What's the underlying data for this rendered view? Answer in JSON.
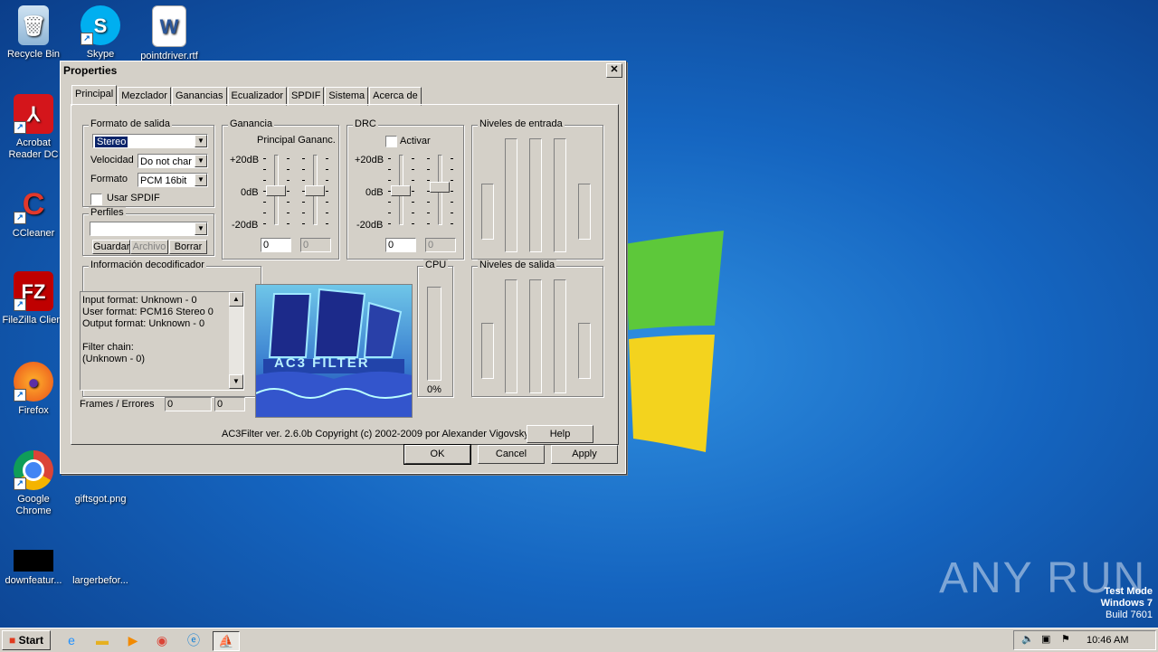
{
  "desktop": {
    "icons": [
      {
        "label": "Recycle Bin",
        "icon": "recycle-bin-icon"
      },
      {
        "label": "Skype",
        "icon": "skype-icon"
      },
      {
        "label": "pointdriver.rtf",
        "icon": "word-document-icon"
      },
      {
        "label": "Acrobat Reader DC",
        "icon": "acrobat-icon"
      },
      {
        "label": "CCleaner",
        "icon": "ccleaner-icon"
      },
      {
        "label": "FileZilla Client",
        "icon": "filezilla-icon"
      },
      {
        "label": "Firefox",
        "icon": "firefox-icon"
      },
      {
        "label": "Google Chrome",
        "icon": "chrome-icon"
      },
      {
        "label": "giftsgot.png",
        "icon": "image-file-icon"
      },
      {
        "label": "downfeatur...",
        "icon": "black-image-icon"
      },
      {
        "label": "largerbefor...",
        "icon": "image-file-icon"
      }
    ],
    "watermark": "ANY RUN",
    "test_mode": [
      "Test Mode",
      "Windows 7",
      "Build 7601"
    ]
  },
  "dialog": {
    "title": "Properties",
    "close_glyph": "✕",
    "tabs": [
      "Principal",
      "Mezclador",
      "Ganancias",
      "Ecualizador",
      "SPDIF",
      "Sistema",
      "Acerca de"
    ],
    "active_tab": "Principal",
    "output": {
      "group": "Formato de salida",
      "format_value": "Stereo",
      "speed_label": "Velocidad",
      "speed_value": "Do not char",
      "format_label": "Formato",
      "pcm_value": "PCM 16bit",
      "spdif_label": "Usar SPDIF"
    },
    "profiles": {
      "group": "Perfiles",
      "value": "",
      "save": "Guardar",
      "file": "Archivo",
      "delete": "Borrar"
    },
    "gain": {
      "group": "Ganancia",
      "subtitle": "Principal Gananc.",
      "plus": "+20dB",
      "zero": "0dB",
      "minus": "-20dB",
      "value1": "0",
      "value2": "0"
    },
    "drc": {
      "group": "DRC",
      "activate": "Activar",
      "plus": "+20dB",
      "zero": "0dB",
      "minus": "-20dB",
      "value1": "0",
      "value2": "0"
    },
    "input_levels": "Niveles de entrada",
    "output_levels": "Niveles de salida",
    "decoder": {
      "group": "Información decodificador",
      "text": "Input format: Unknown - 0\nUser format: PCM16 Stereo 0\nOutput format: Unknown - 0\n\nFilter chain:\n(Unknown - 0)",
      "frames_label": "Frames / Errores",
      "frames": "0",
      "errors": "0"
    },
    "logo_text": "AC3 FILTER",
    "cpu": {
      "label": "CPU",
      "value": "0%"
    },
    "copyright": "AC3Filter ver. 2.6.0b Copyright (c) 2002-2009 por Alexander Vigovsky",
    "help": "Help",
    "ok": "OK",
    "cancel": "Cancel",
    "apply": "Apply"
  },
  "taskbar": {
    "start": "Start",
    "clock": "10:46 AM",
    "apps": [
      "ie-icon",
      "explorer-icon",
      "media-player-icon",
      "chrome-icon",
      "edge-icon",
      "ac3filter-icon"
    ]
  }
}
